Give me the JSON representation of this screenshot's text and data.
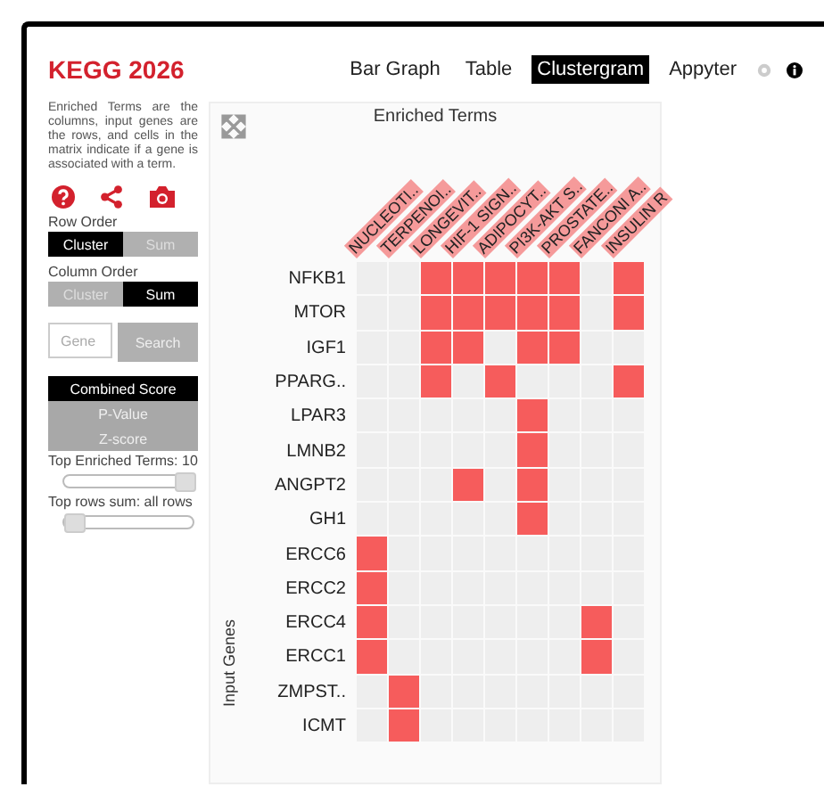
{
  "header": {
    "title": "KEGG 2026",
    "nav": [
      {
        "label": "Bar Graph",
        "selected": false
      },
      {
        "label": "Table",
        "selected": false
      },
      {
        "label": "Clustergram",
        "selected": true
      },
      {
        "label": "Appyter",
        "selected": false
      }
    ]
  },
  "sidebar": {
    "description": "Enriched Terms are the columns, input genes are the rows, and cells in the matrix indicate if a gene is associated with a term.",
    "row_order": {
      "label": "Row Order",
      "options": [
        {
          "label": "Cluster",
          "selected": true
        },
        {
          "label": "Sum",
          "selected": false
        }
      ]
    },
    "column_order": {
      "label": "Column Order",
      "options": [
        {
          "label": "Cluster",
          "selected": false
        },
        {
          "label": "Sum",
          "selected": true
        }
      ]
    },
    "search": {
      "placeholder": "Gene",
      "button": "Search"
    },
    "score_options": [
      {
        "label": "Combined Score",
        "selected": true
      },
      {
        "label": "P-Value",
        "selected": false
      },
      {
        "label": "Z-score",
        "selected": false
      }
    ],
    "sliders": [
      {
        "label": "Top Enriched Terms: 10",
        "level": 1
      },
      {
        "label": "Top rows sum: all rows",
        "level": 0
      }
    ]
  },
  "clustergram": {
    "title": "Enriched Terms",
    "y_axis_label": "Input Genes",
    "columns": [
      "NUCLEOTI..",
      "TERPENOI..",
      "LONGEVIT..",
      "HIF-1 SIGN..",
      "ADIPOCYT..",
      "PI3K-AKT S..",
      "PROSTATE..",
      "FANCONI A..",
      "INSULIN R"
    ],
    "rows": [
      {
        "gene": "NFKB1",
        "cells": [
          false,
          false,
          true,
          true,
          true,
          true,
          true,
          false,
          true
        ]
      },
      {
        "gene": "MTOR",
        "cells": [
          false,
          false,
          true,
          true,
          true,
          true,
          true,
          false,
          true
        ]
      },
      {
        "gene": "IGF1",
        "cells": [
          false,
          false,
          true,
          true,
          false,
          true,
          true,
          false,
          false
        ]
      },
      {
        "gene": "PPARG..",
        "cells": [
          false,
          false,
          true,
          false,
          true,
          false,
          false,
          false,
          true
        ]
      },
      {
        "gene": "LPAR3",
        "cells": [
          false,
          false,
          false,
          false,
          false,
          true,
          false,
          false,
          false
        ]
      },
      {
        "gene": "LMNB2",
        "cells": [
          false,
          false,
          false,
          false,
          false,
          true,
          false,
          false,
          false
        ]
      },
      {
        "gene": "ANGPT2",
        "cells": [
          false,
          false,
          false,
          true,
          false,
          true,
          false,
          false,
          false
        ]
      },
      {
        "gene": "GH1",
        "cells": [
          false,
          false,
          false,
          false,
          false,
          true,
          false,
          false,
          false
        ]
      },
      {
        "gene": "ERCC6",
        "cells": [
          true,
          false,
          false,
          false,
          false,
          false,
          false,
          false,
          false
        ]
      },
      {
        "gene": "ERCC2",
        "cells": [
          true,
          false,
          false,
          false,
          false,
          false,
          false,
          false,
          false
        ]
      },
      {
        "gene": "ERCC4",
        "cells": [
          true,
          false,
          false,
          false,
          false,
          false,
          false,
          true,
          false
        ]
      },
      {
        "gene": "ERCC1",
        "cells": [
          true,
          false,
          false,
          false,
          false,
          false,
          false,
          true,
          false
        ]
      },
      {
        "gene": "ZMPST..",
        "cells": [
          false,
          true,
          false,
          false,
          false,
          false,
          false,
          false,
          false
        ]
      },
      {
        "gene": "ICMT",
        "cells": [
          false,
          true,
          false,
          false,
          false,
          false,
          false,
          false,
          false
        ]
      }
    ]
  }
}
